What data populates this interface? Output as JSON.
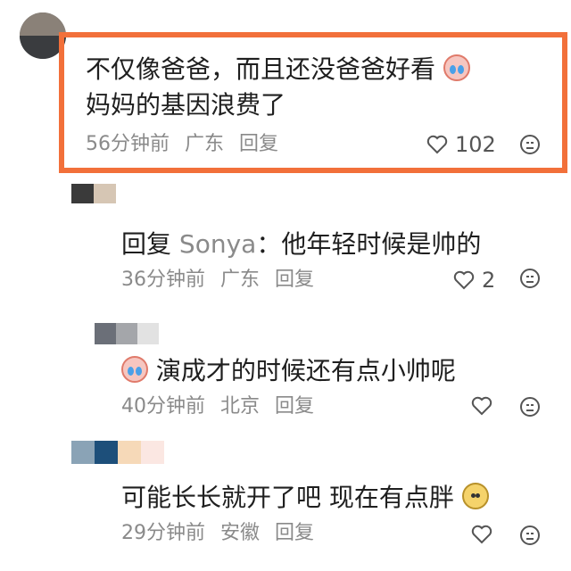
{
  "comments": [
    {
      "text": "不仅像爸爸，而且还没爸爸好看",
      "text_line2": "妈妈的基因浪费了",
      "emoji": "crying-laughing-emoji",
      "time": "56分钟前",
      "location": "广东",
      "reply_label": "回复",
      "likes": "102",
      "highlighted": true,
      "highlight_color": "#f2703a"
    },
    {
      "reply_prefix": "回复",
      "reply_to": "Sonya",
      "text": "：他年轻时候是帅的",
      "time": "36分钟前",
      "location": "广东",
      "reply_label": "回复",
      "likes": "2"
    },
    {
      "emoji": "crying-laughing-emoji",
      "text": "演成才的时候还有点小帅呢",
      "time": "40分钟前",
      "location": "北京",
      "reply_label": "回复"
    },
    {
      "text": "可能长长就开了吧 现在有点胖",
      "emoji": "smiling-pear-emoji",
      "time": "29分钟前",
      "location": "安徽",
      "reply_label": "回复"
    }
  ],
  "icons": {
    "like": "heart-outline-icon",
    "dislike": "neutral-face-icon"
  }
}
